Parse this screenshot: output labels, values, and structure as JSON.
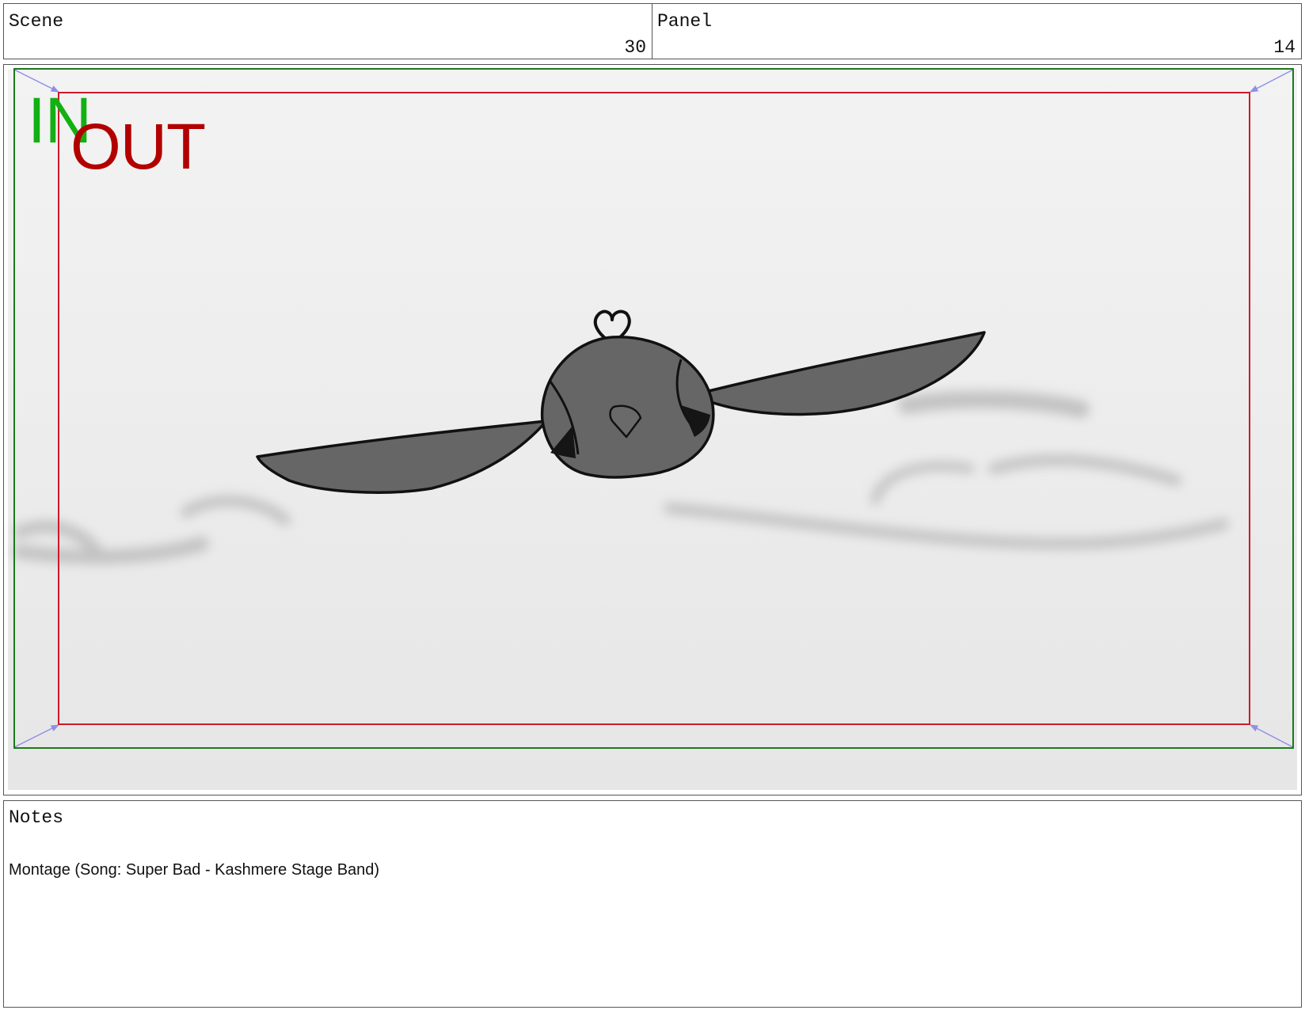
{
  "header": {
    "scene_label": "Scene",
    "scene_number": "30",
    "panel_label": "Panel",
    "panel_number": "14"
  },
  "frame": {
    "in_label": "IN",
    "out_label": "OUT",
    "colors": {
      "in_border": "#1a7a1a",
      "out_border": "#cc1a2a",
      "in_text": "#12b012",
      "out_text": "#b20000",
      "camera_arrow": "#8f8fe8"
    },
    "illustration": "flying-bird-icon"
  },
  "notes": {
    "label": "Notes",
    "text": "Montage (Song: Super Bad - Kashmere Stage Band)"
  }
}
